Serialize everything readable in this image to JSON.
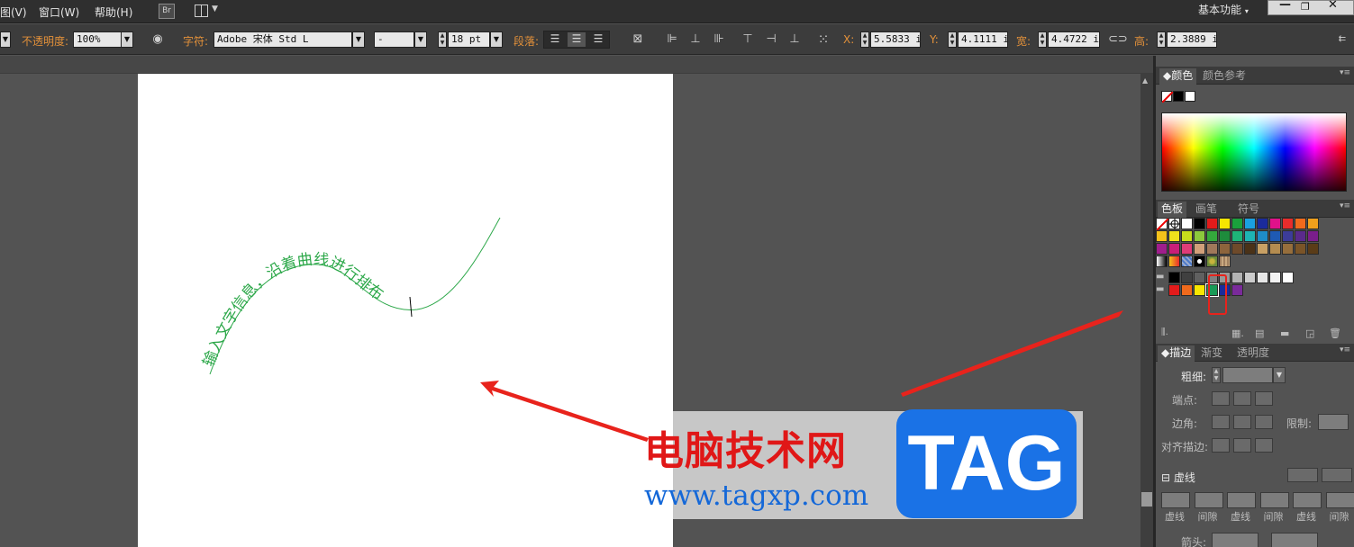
{
  "menu": {
    "view": "图(V)",
    "window": "窗口(W)",
    "help": "帮助(H)",
    "bridge": "Br",
    "workspace": "基本功能"
  },
  "control_bar": {
    "opacity_label": "不透明度:",
    "opacity_value": "100%",
    "char_label": "字符:",
    "font_value": "Adobe 宋体 Std L",
    "style_value": "-",
    "size_value": "18 pt",
    "para_label": "段落:",
    "x_label": "X:",
    "x_value": "5.5833 i:",
    "y_label": "Y:",
    "y_value": "4.1111 i:",
    "w_label": "宽:",
    "w_value": "4.4722 i:",
    "h_label": "高:",
    "h_value": "2.3889 i:"
  },
  "canvas": {
    "path_text": "输入文字信息，沿着曲线进行排布",
    "path_color": "#2da84a"
  },
  "color_panel": {
    "tab_color": "颜色",
    "tab_color_ref": "颜色参考"
  },
  "swatch_panel": {
    "tab_swatches": "色板",
    "tab_brushes": "画笔",
    "tab_symbols": "符号",
    "selected_color": "#1a9a57"
  },
  "stroke_panel": {
    "tab_stroke": "描边",
    "tab_gradient": "渐变",
    "tab_transparency": "透明度",
    "weight_label": "粗细:",
    "cap_label": "端点:",
    "corner_label": "边角:",
    "limit_label": "限制:",
    "align_label": "对齐描边:",
    "dashed_label": "虚线",
    "dash_labels": [
      "虚线",
      "间隙",
      "虚线",
      "间隙",
      "虚线",
      "间隙"
    ],
    "arrow_label": "箭头:"
  },
  "watermark": {
    "title": "电脑技术网",
    "url": "www.tagxp.com",
    "logo": "TAG"
  },
  "colors": {
    "arrow_red": "#e8231c",
    "bg_dark": "#535353"
  }
}
